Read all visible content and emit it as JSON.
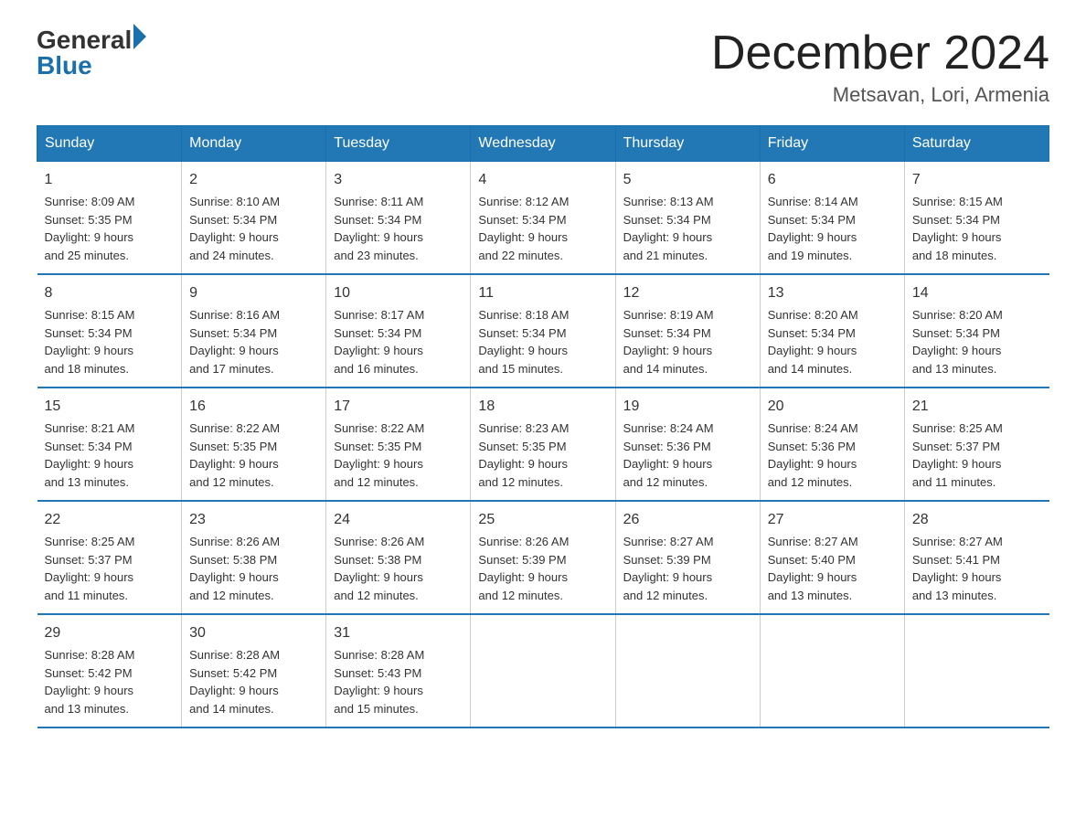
{
  "header": {
    "logo_general": "General",
    "logo_blue": "Blue",
    "title": "December 2024",
    "subtitle": "Metsavan, Lori, Armenia"
  },
  "days_of_week": [
    "Sunday",
    "Monday",
    "Tuesday",
    "Wednesday",
    "Thursday",
    "Friday",
    "Saturday"
  ],
  "weeks": [
    [
      {
        "day": "1",
        "sunrise": "8:09 AM",
        "sunset": "5:35 PM",
        "daylight": "9 hours and 25 minutes."
      },
      {
        "day": "2",
        "sunrise": "8:10 AM",
        "sunset": "5:34 PM",
        "daylight": "9 hours and 24 minutes."
      },
      {
        "day": "3",
        "sunrise": "8:11 AM",
        "sunset": "5:34 PM",
        "daylight": "9 hours and 23 minutes."
      },
      {
        "day": "4",
        "sunrise": "8:12 AM",
        "sunset": "5:34 PM",
        "daylight": "9 hours and 22 minutes."
      },
      {
        "day": "5",
        "sunrise": "8:13 AM",
        "sunset": "5:34 PM",
        "daylight": "9 hours and 21 minutes."
      },
      {
        "day": "6",
        "sunrise": "8:14 AM",
        "sunset": "5:34 PM",
        "daylight": "9 hours and 19 minutes."
      },
      {
        "day": "7",
        "sunrise": "8:15 AM",
        "sunset": "5:34 PM",
        "daylight": "9 hours and 18 minutes."
      }
    ],
    [
      {
        "day": "8",
        "sunrise": "8:15 AM",
        "sunset": "5:34 PM",
        "daylight": "9 hours and 18 minutes."
      },
      {
        "day": "9",
        "sunrise": "8:16 AM",
        "sunset": "5:34 PM",
        "daylight": "9 hours and 17 minutes."
      },
      {
        "day": "10",
        "sunrise": "8:17 AM",
        "sunset": "5:34 PM",
        "daylight": "9 hours and 16 minutes."
      },
      {
        "day": "11",
        "sunrise": "8:18 AM",
        "sunset": "5:34 PM",
        "daylight": "9 hours and 15 minutes."
      },
      {
        "day": "12",
        "sunrise": "8:19 AM",
        "sunset": "5:34 PM",
        "daylight": "9 hours and 14 minutes."
      },
      {
        "day": "13",
        "sunrise": "8:20 AM",
        "sunset": "5:34 PM",
        "daylight": "9 hours and 14 minutes."
      },
      {
        "day": "14",
        "sunrise": "8:20 AM",
        "sunset": "5:34 PM",
        "daylight": "9 hours and 13 minutes."
      }
    ],
    [
      {
        "day": "15",
        "sunrise": "8:21 AM",
        "sunset": "5:34 PM",
        "daylight": "9 hours and 13 minutes."
      },
      {
        "day": "16",
        "sunrise": "8:22 AM",
        "sunset": "5:35 PM",
        "daylight": "9 hours and 12 minutes."
      },
      {
        "day": "17",
        "sunrise": "8:22 AM",
        "sunset": "5:35 PM",
        "daylight": "9 hours and 12 minutes."
      },
      {
        "day": "18",
        "sunrise": "8:23 AM",
        "sunset": "5:35 PM",
        "daylight": "9 hours and 12 minutes."
      },
      {
        "day": "19",
        "sunrise": "8:24 AM",
        "sunset": "5:36 PM",
        "daylight": "9 hours and 12 minutes."
      },
      {
        "day": "20",
        "sunrise": "8:24 AM",
        "sunset": "5:36 PM",
        "daylight": "9 hours and 12 minutes."
      },
      {
        "day": "21",
        "sunrise": "8:25 AM",
        "sunset": "5:37 PM",
        "daylight": "9 hours and 11 minutes."
      }
    ],
    [
      {
        "day": "22",
        "sunrise": "8:25 AM",
        "sunset": "5:37 PM",
        "daylight": "9 hours and 11 minutes."
      },
      {
        "day": "23",
        "sunrise": "8:26 AM",
        "sunset": "5:38 PM",
        "daylight": "9 hours and 12 minutes."
      },
      {
        "day": "24",
        "sunrise": "8:26 AM",
        "sunset": "5:38 PM",
        "daylight": "9 hours and 12 minutes."
      },
      {
        "day": "25",
        "sunrise": "8:26 AM",
        "sunset": "5:39 PM",
        "daylight": "9 hours and 12 minutes."
      },
      {
        "day": "26",
        "sunrise": "8:27 AM",
        "sunset": "5:39 PM",
        "daylight": "9 hours and 12 minutes."
      },
      {
        "day": "27",
        "sunrise": "8:27 AM",
        "sunset": "5:40 PM",
        "daylight": "9 hours and 13 minutes."
      },
      {
        "day": "28",
        "sunrise": "8:27 AM",
        "sunset": "5:41 PM",
        "daylight": "9 hours and 13 minutes."
      }
    ],
    [
      {
        "day": "29",
        "sunrise": "8:28 AM",
        "sunset": "5:42 PM",
        "daylight": "9 hours and 13 minutes."
      },
      {
        "day": "30",
        "sunrise": "8:28 AM",
        "sunset": "5:42 PM",
        "daylight": "9 hours and 14 minutes."
      },
      {
        "day": "31",
        "sunrise": "8:28 AM",
        "sunset": "5:43 PM",
        "daylight": "9 hours and 15 minutes."
      },
      {
        "day": "",
        "sunrise": "",
        "sunset": "",
        "daylight": ""
      },
      {
        "day": "",
        "sunrise": "",
        "sunset": "",
        "daylight": ""
      },
      {
        "day": "",
        "sunrise": "",
        "sunset": "",
        "daylight": ""
      },
      {
        "day": "",
        "sunrise": "",
        "sunset": "",
        "daylight": ""
      }
    ]
  ],
  "labels": {
    "sunrise": "Sunrise: ",
    "sunset": "Sunset: ",
    "daylight": "Daylight: "
  }
}
